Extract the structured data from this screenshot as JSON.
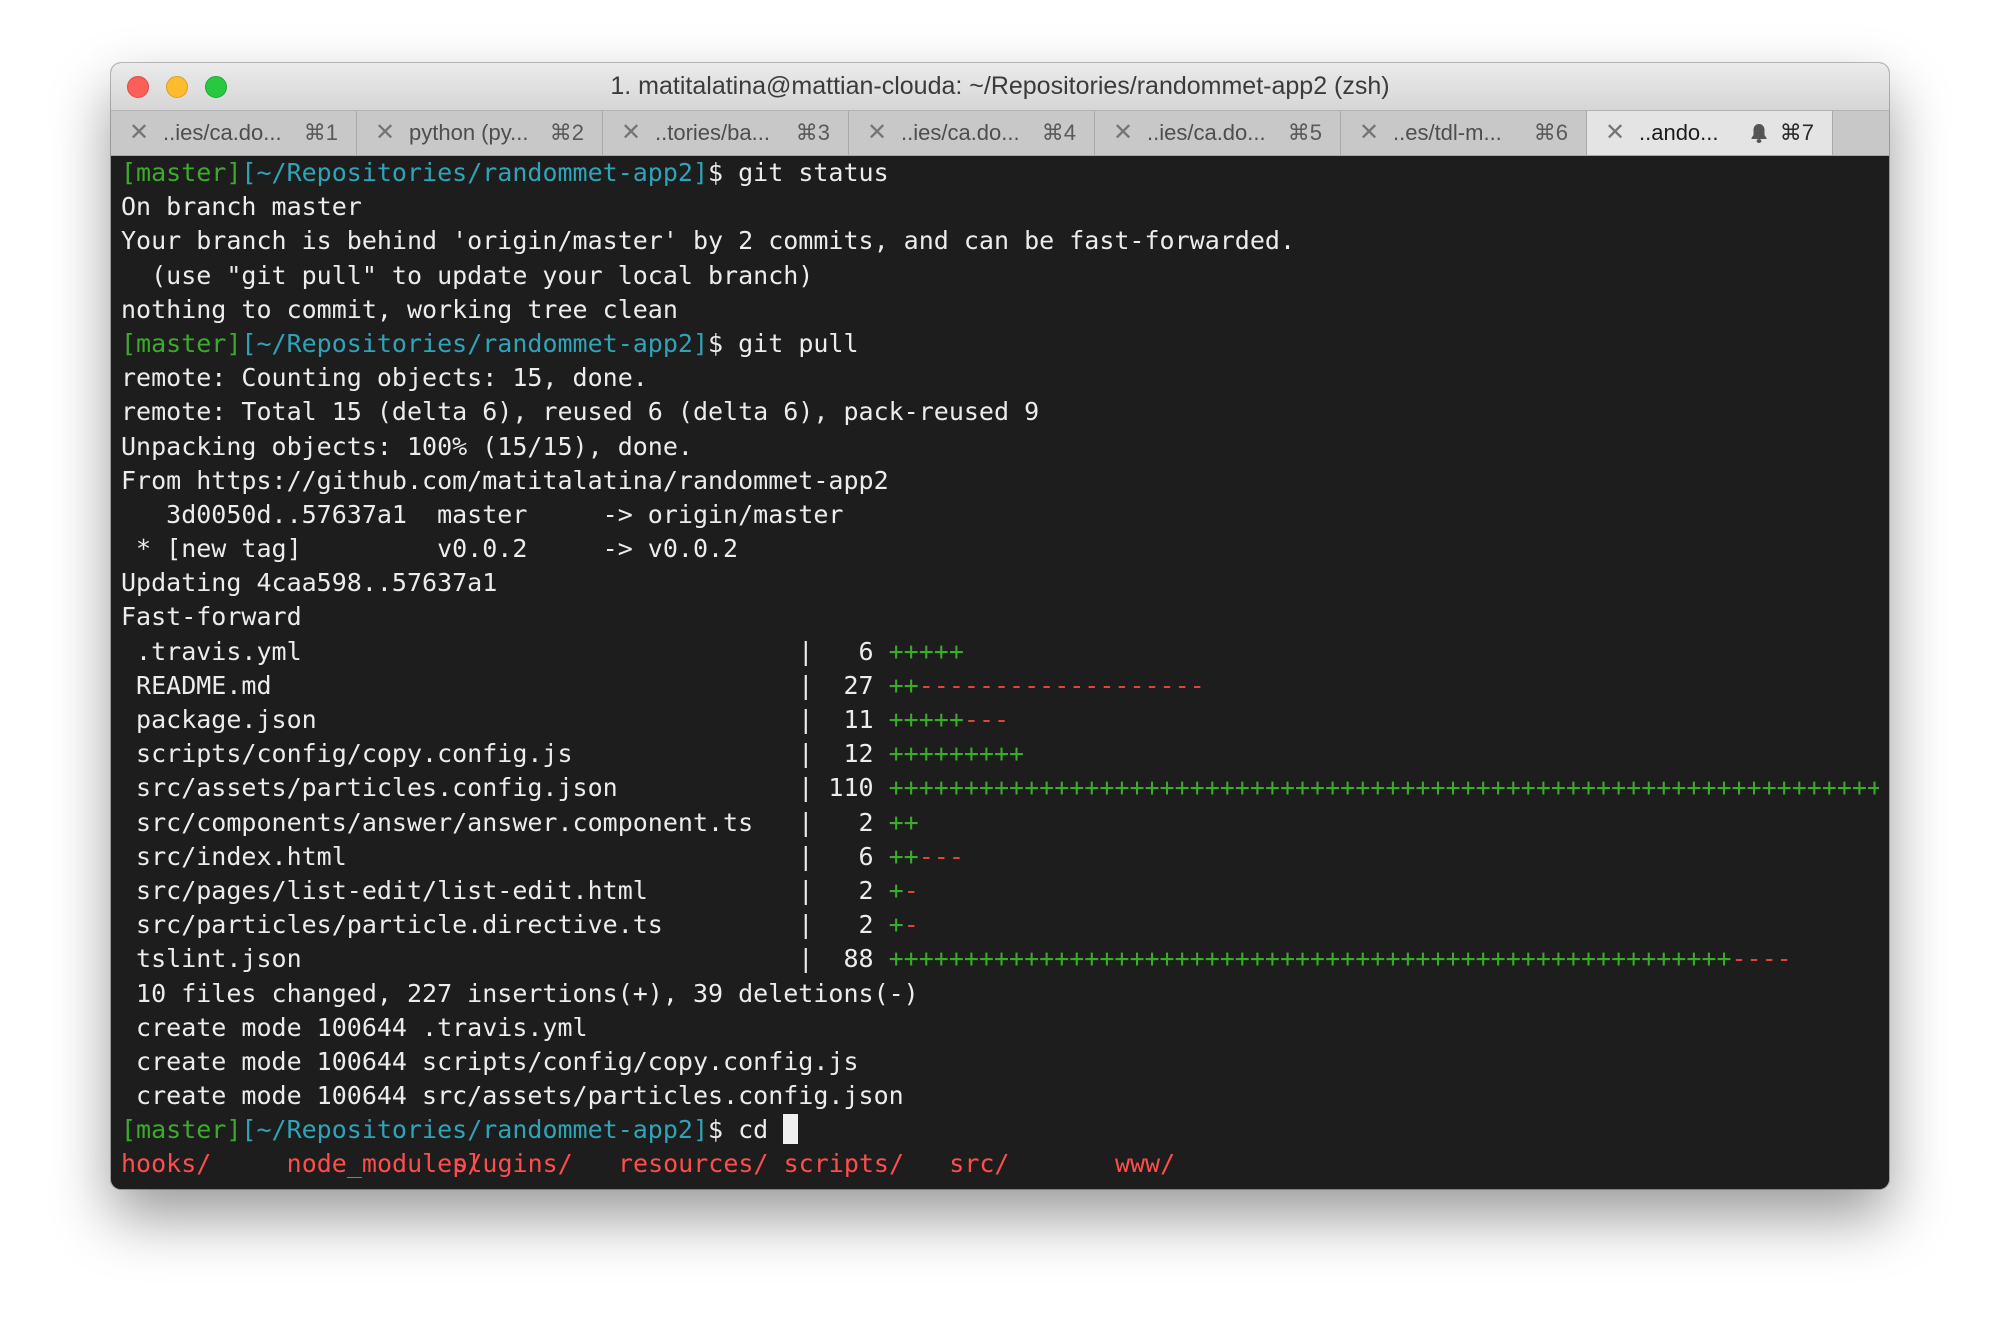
{
  "window": {
    "title": "1. matitalatina@mattian-clouda: ~/Repositories/randommet-app2 (zsh)"
  },
  "tabs": [
    {
      "label": "..ies/ca.do...",
      "shortcut": "⌘1",
      "active": false
    },
    {
      "label": "python (py...",
      "shortcut": "⌘2",
      "active": false
    },
    {
      "label": "..tories/ba...",
      "shortcut": "⌘3",
      "active": false
    },
    {
      "label": "..ies/ca.do...",
      "shortcut": "⌘4",
      "active": false
    },
    {
      "label": "..ies/ca.do...",
      "shortcut": "⌘5",
      "active": false
    },
    {
      "label": "..es/tdl-m...",
      "shortcut": "⌘6",
      "active": false
    },
    {
      "label": "..ando...",
      "shortcut": "⌘7",
      "active": true,
      "icon": "bell-icon"
    }
  ],
  "terminal": {
    "prompt": {
      "branch": "[master]",
      "path": "[~/Repositories/randommet-app2]",
      "symbol": "$"
    },
    "commands": [
      " git status",
      " git pull",
      " cd "
    ],
    "status_output": [
      "On branch master",
      "Your branch is behind 'origin/master' by 2 commits, and can be fast-forwarded.",
      "  (use \"git pull\" to update your local branch)",
      "nothing to commit, working tree clean"
    ],
    "pull_output": [
      "remote: Counting objects: 15, done.",
      "remote: Total 15 (delta 6), reused 6 (delta 6), pack-reused 9",
      "Unpacking objects: 100% (15/15), done.",
      "From https://github.com/matitalatina/randommet-app2",
      "   3d0050d..57637a1  master     -> origin/master",
      " * [new tag]         v0.0.2     -> v0.0.2",
      "Updating 4caa598..57637a1",
      "Fast-forward"
    ],
    "diffstat": [
      {
        "text": " .travis.yml                                 |   6 ",
        "plus": "+++++",
        "minus": ""
      },
      {
        "text": " README.md                                   |  27 ",
        "plus": "++",
        "minus": "-------------------"
      },
      {
        "text": " package.json                                |  11 ",
        "plus": "+++++",
        "minus": "---"
      },
      {
        "text": " scripts/config/copy.config.js               |  12 ",
        "plus": "+++++++++",
        "minus": ""
      },
      {
        "text": " src/assets/particles.config.json            | 110 ",
        "plus": "+++++++++++++++++++++++++++++++++++++++++++++++++++++++++++++++++++++++++++",
        "minus": ""
      },
      {
        "text": " src/components/answer/answer.component.ts   |   2 ",
        "plus": "++",
        "minus": ""
      },
      {
        "text": " src/index.html                              |   6 ",
        "plus": "++",
        "minus": "---"
      },
      {
        "text": " src/pages/list-edit/list-edit.html          |   2 ",
        "plus": "+",
        "minus": "-"
      },
      {
        "text": " src/particles/particle.directive.ts         |   2 ",
        "plus": "+",
        "minus": "-"
      },
      {
        "text": " tslint.json                                 |  88 ",
        "plus": "++++++++++++++++++++++++++++++++++++++++++++++++++++++++",
        "minus": "----"
      }
    ],
    "summary": [
      " 10 files changed, 227 insertions(+), 39 deletions(-)",
      " create mode 100644 .travis.yml",
      " create mode 100644 scripts/config/copy.config.js",
      " create mode 100644 src/assets/particles.config.json"
    ],
    "completions": [
      "hooks/",
      "node_modules/",
      "plugins/",
      "resources/",
      "scripts/",
      "src/",
      "www/"
    ]
  },
  "colors": {
    "prompt_branch": "#3bac2a",
    "prompt_path": "#2fa3b7",
    "diff_plus": "#3bac2a",
    "diff_minus": "#e0443a",
    "directory": "#ff4d4d",
    "background": "#1d1d1d"
  }
}
